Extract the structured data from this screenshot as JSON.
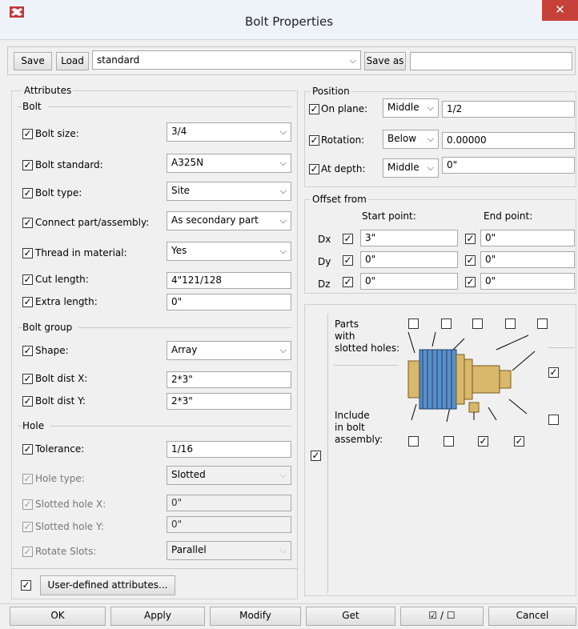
{
  "window": {
    "title": "Bolt Properties",
    "close_glyph": "✕"
  },
  "toolbar": {
    "save": "Save",
    "load": "Load",
    "preset": "standard",
    "save_as": "Save as",
    "save_as_value": ""
  },
  "attributes": {
    "legend": "Attributes",
    "bolt_section": "Bolt",
    "bolt_size": {
      "label": "Bolt size:",
      "value": "3/4",
      "checked": true
    },
    "bolt_standard": {
      "label": "Bolt standard:",
      "value": "A325N",
      "checked": true
    },
    "bolt_type": {
      "label": "Bolt type:",
      "value": "Site",
      "checked": true
    },
    "connect": {
      "label": "Connect part/assembly:",
      "value": "As secondary part",
      "checked": true
    },
    "thread": {
      "label": "Thread in material:",
      "value": "Yes",
      "checked": true
    },
    "cut_length": {
      "label": "Cut length:",
      "value": "4\"121/128",
      "checked": true
    },
    "extra_length": {
      "label": "Extra length:",
      "value": "0\"",
      "checked": true
    },
    "group_section": "Bolt group",
    "shape": {
      "label": "Shape:",
      "value": "Array",
      "checked": true
    },
    "dist_x": {
      "label": "Bolt dist X:",
      "value": "2*3\"",
      "checked": true
    },
    "dist_y": {
      "label": "Bolt dist Y:",
      "value": "2*3\"",
      "checked": true
    },
    "hole_section": "Hole",
    "tolerance": {
      "label": "Tolerance:",
      "value": "1/16",
      "checked": true
    },
    "hole_type": {
      "label": "Hole type:",
      "value": "Slotted"
    },
    "slot_x": {
      "label": "Slotted hole X:",
      "value": "0\""
    },
    "slot_y": {
      "label": "Slotted hole Y:",
      "value": "0\""
    },
    "rotate": {
      "label": "Rotate Slots:",
      "value": "Parallel"
    },
    "uda_button": "User-defined attributes..."
  },
  "position": {
    "legend": "Position",
    "on_plane": {
      "label": "On plane:",
      "option": "Middle",
      "value": "1/2"
    },
    "rotation": {
      "label": "Rotation:",
      "option": "Below",
      "value": "0.00000"
    },
    "at_depth": {
      "label": "At depth:",
      "option": "Middle",
      "value": "0\""
    }
  },
  "offset": {
    "legend": "Offset from",
    "start_header": "Start point:",
    "end_header": "End point:",
    "rows": [
      {
        "axis": "Dx",
        "start": "3\"",
        "end": "0\""
      },
      {
        "axis": "Dy",
        "start": "0\"",
        "end": "0\""
      },
      {
        "axis": "Dz",
        "start": "0\"",
        "end": "0\""
      }
    ]
  },
  "assembly": {
    "slotted_label": "Parts\nwith\nslotted holes:",
    "include_label": "Include\nin bolt\nassembly:"
  },
  "footer": {
    "ok": "OK",
    "apply": "Apply",
    "modify": "Modify",
    "get": "Get",
    "toggle": "☑ / ☐",
    "cancel": "Cancel"
  },
  "glyphs": {
    "check": "✓",
    "arrow": "⌵"
  },
  "colors": {
    "close": "#c7413b",
    "bolt_body": "#5a8fc8",
    "nut": "#d8b86a"
  }
}
